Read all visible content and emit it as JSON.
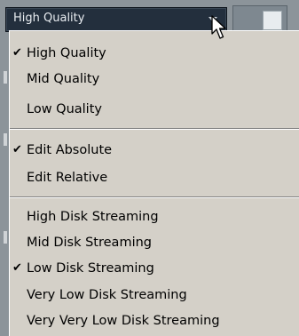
{
  "combo": {
    "value": "High Quality"
  },
  "menu": {
    "quality": [
      {
        "label": "High Quality",
        "checked": true
      },
      {
        "label": "Mid Quality",
        "checked": false
      },
      {
        "label": "Low Quality",
        "checked": false
      }
    ],
    "edit_mode": [
      {
        "label": "Edit Absolute",
        "checked": true
      },
      {
        "label": "Edit Relative",
        "checked": false
      }
    ],
    "disk_streaming": [
      {
        "label": "High Disk Streaming",
        "checked": false
      },
      {
        "label": "Mid Disk Streaming",
        "checked": false
      },
      {
        "label": "Low Disk Streaming",
        "checked": true
      },
      {
        "label": "Very Low Disk Streaming",
        "checked": false
      },
      {
        "label": "Very Very Low Disk Streaming",
        "checked": false
      }
    ],
    "check_glyph": "✔"
  },
  "colors": {
    "combo_bg": "#232f3d",
    "menu_bg": "#d4d0c8",
    "backdrop": "#8c949a"
  }
}
